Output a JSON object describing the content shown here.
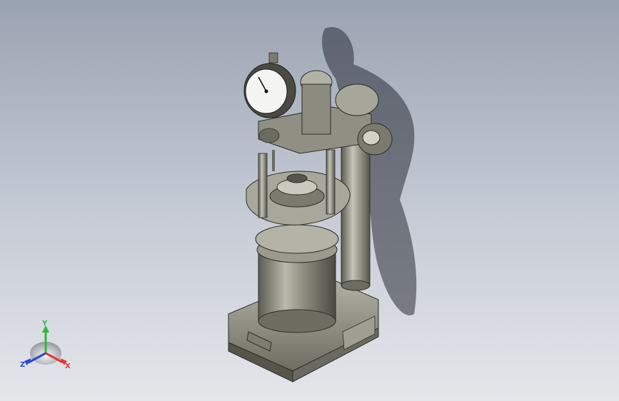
{
  "viewport": {
    "background_top": "#9aa3b2",
    "background_bottom": "#e4e6ea"
  },
  "model": {
    "body_color": "#8c8c7e",
    "highlight_color": "#d6d6cc",
    "shadow_color": "#3f3f38",
    "dial_face_color": "#f4f4f2"
  },
  "triad": {
    "x_label": "X",
    "y_label": "Y",
    "z_label": "Z",
    "x_color": "#e23a2e",
    "y_color": "#2fb83a",
    "z_color": "#2a46d8"
  }
}
